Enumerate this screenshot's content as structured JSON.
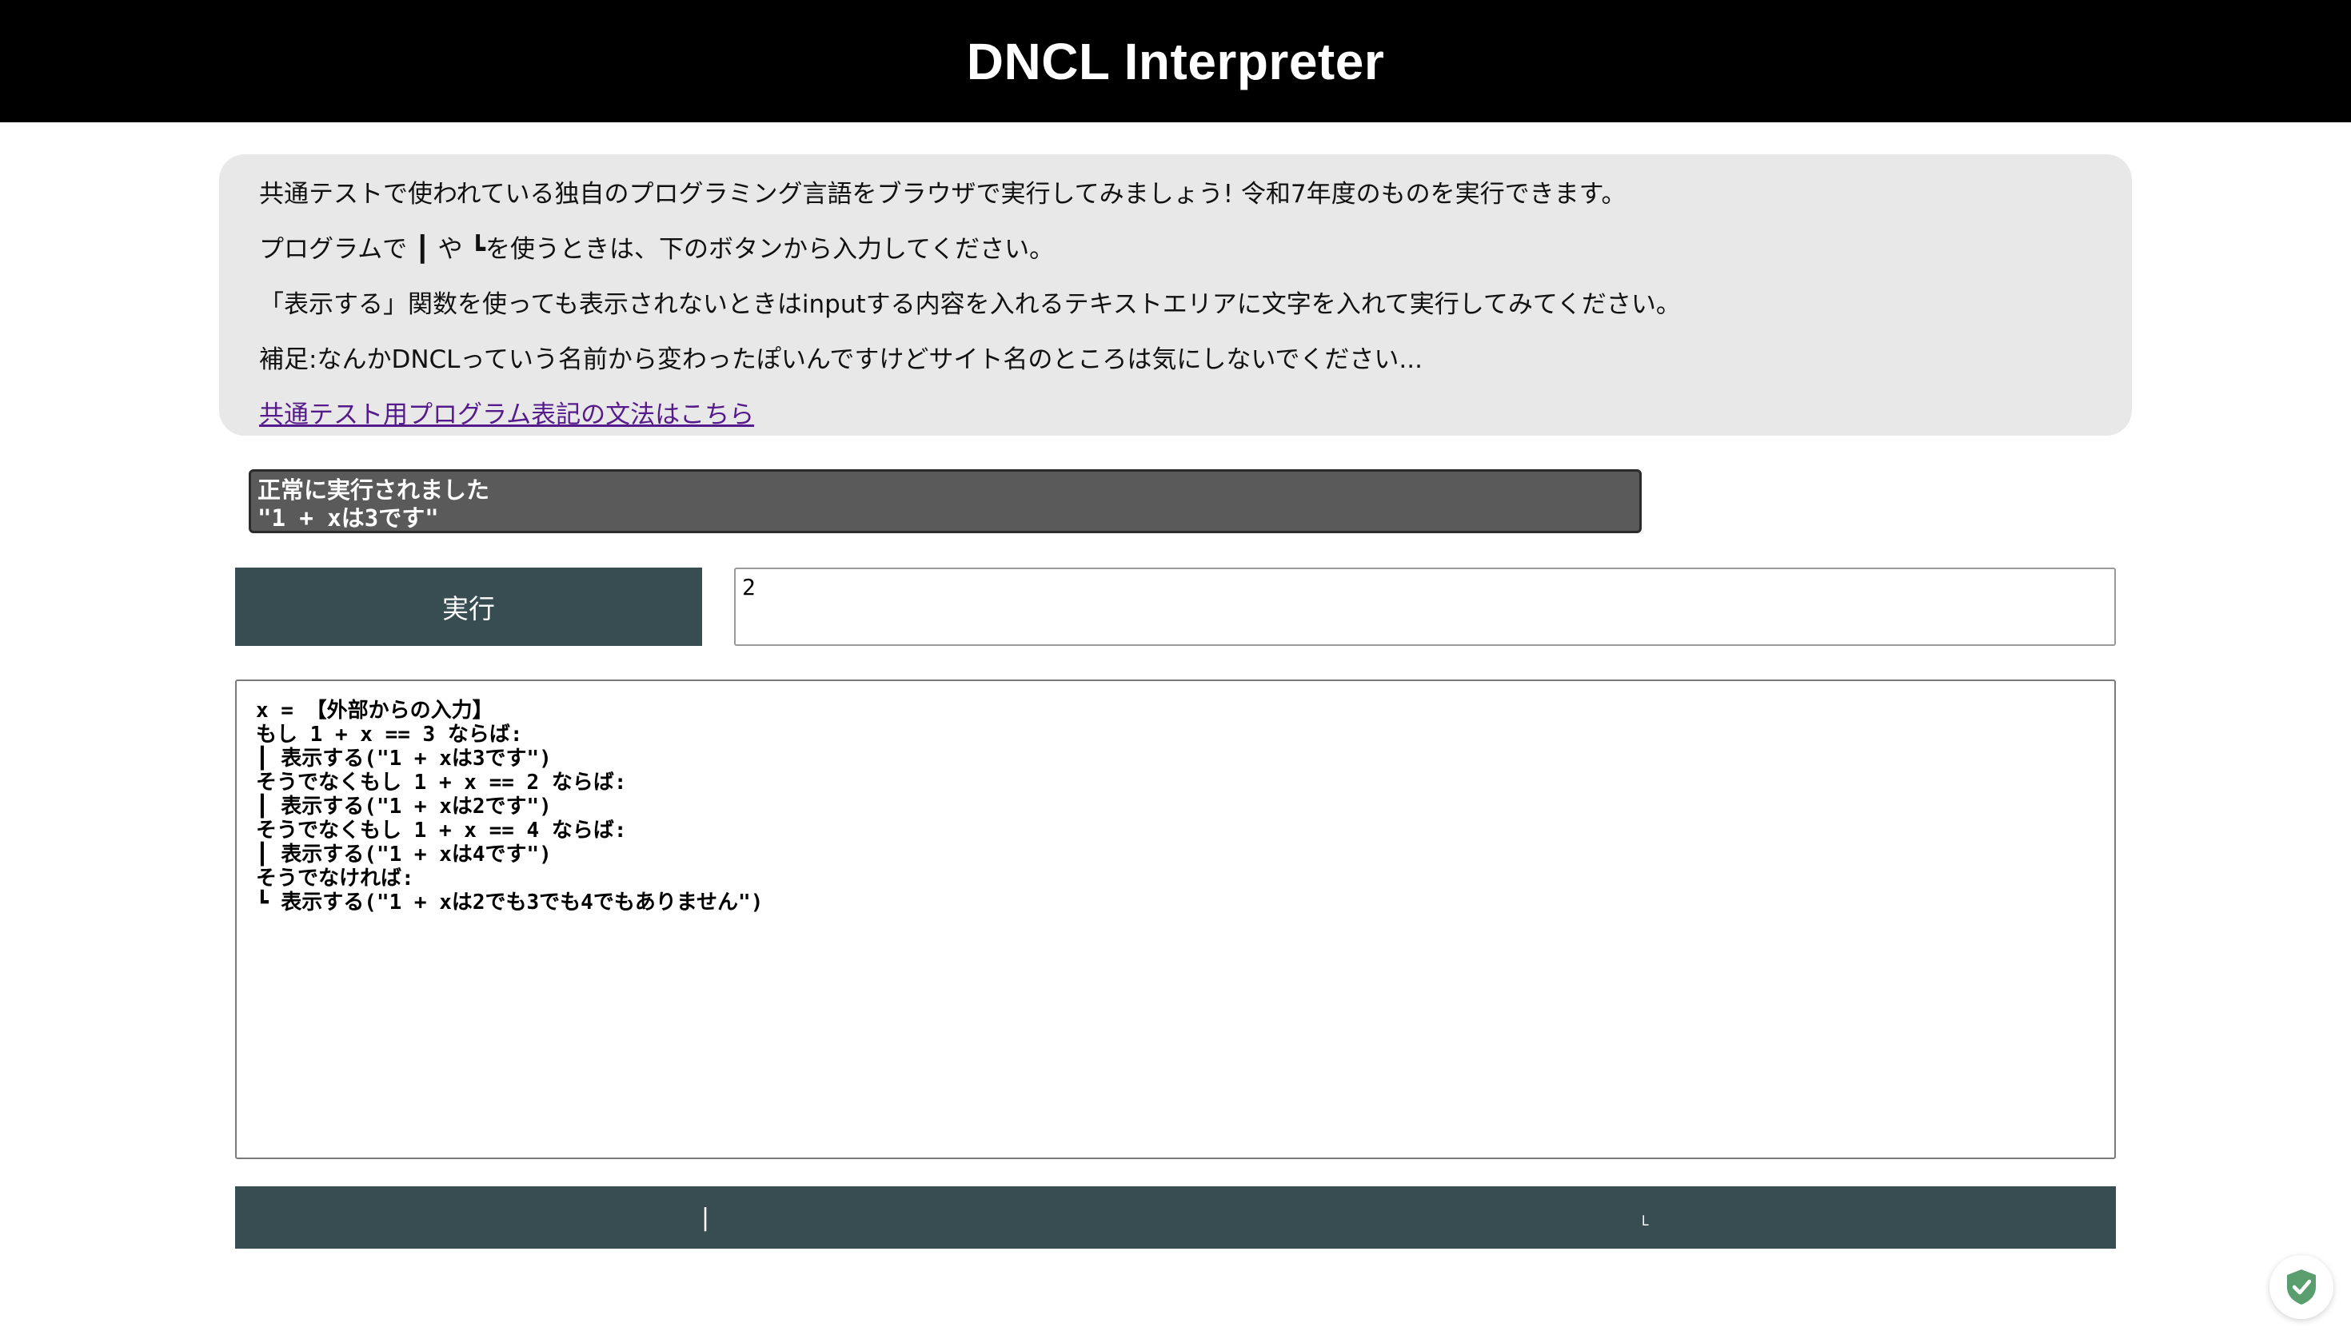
{
  "header": {
    "title": "DNCL Interpreter"
  },
  "info": {
    "lines": [
      "共通テストで使われている独自のプログラミング言語をブラウザで実行してみましょう! 令和7年度のものを実行できます。",
      "プログラムで ┃ や ┗を使うときは、下のボタンから入力してください。",
      "「表示する」関数を使っても表示されないときはinputする内容を入れるテキストエリアに文字を入れて実行してみてください。",
      "補足:なんかDNCLっていう名前から変わったぽいんですけどサイト名のところは気にしないでください..."
    ],
    "link_text": "共通テスト用プログラム表記の文法はこちら"
  },
  "status": {
    "lines": [
      "正常に実行されました",
      "\"1 + xは3です\""
    ]
  },
  "controls": {
    "run_label": "実行",
    "input_value": "2"
  },
  "code": {
    "lines": [
      "x = 【外部からの入力】",
      "もし 1 + x == 3 ならば:",
      "┃ 表示する(\"1 + xは3です\")",
      "そうでなくもし 1 + x == 2 ならば:",
      "┃ 表示する(\"1 + xは2です\")",
      "そうでなくもし 1 + x == 4 ならば:",
      "┃ 表示する(\"1 + xは4です\")",
      "そうでなければ:",
      "┗ 表示する(\"1 + xは2でも3でも4でもありません\")"
    ]
  },
  "symbols": {
    "vertical_bar": "|",
    "corner": "˪"
  },
  "badge": {
    "icon": "shield-check-icon",
    "color": "#5a9e6f"
  }
}
